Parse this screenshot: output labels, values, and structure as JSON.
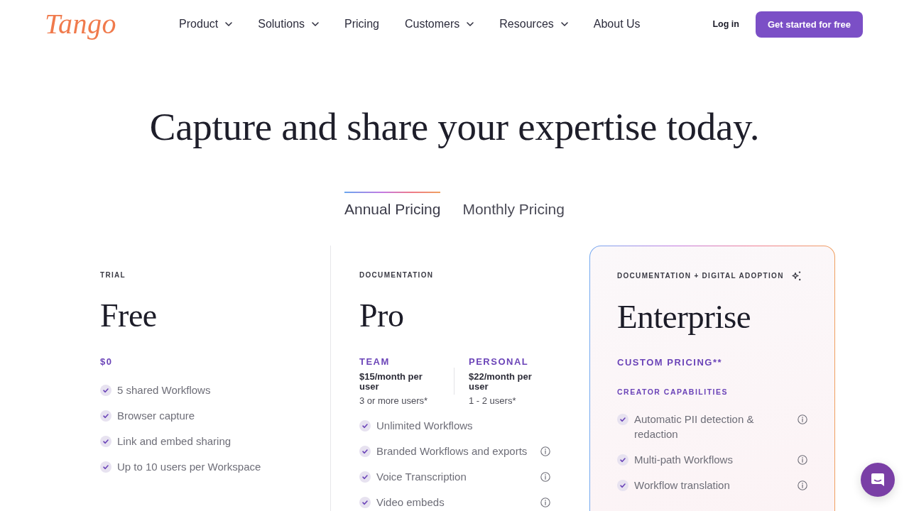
{
  "header": {
    "logo": "Tango",
    "nav": [
      {
        "label": "Product",
        "dropdown": true
      },
      {
        "label": "Solutions",
        "dropdown": true
      },
      {
        "label": "Pricing",
        "dropdown": false
      },
      {
        "label": "Customers",
        "dropdown": true
      },
      {
        "label": "Resources",
        "dropdown": true
      },
      {
        "label": "About Us",
        "dropdown": false
      }
    ],
    "login": "Log in",
    "cta": "Get started for free"
  },
  "headline": "Capture and share your expertise today.",
  "billing_tabs": [
    {
      "label": "Annual Pricing",
      "selected": true
    },
    {
      "label": "Monthly Pricing",
      "selected": false
    }
  ],
  "plans": [
    {
      "category": "TRIAL",
      "name": "Free",
      "featured": false,
      "price": "$0",
      "features": [
        {
          "text": "5 shared Workflows",
          "info": false
        },
        {
          "text": "Browser capture",
          "info": false
        },
        {
          "text": "Link and embed sharing",
          "info": false
        },
        {
          "text": "Up to 10 users per Workspace",
          "info": false
        }
      ]
    },
    {
      "category": "DOCUMENTATION",
      "name": "Pro",
      "featured": false,
      "tiers": [
        {
          "name": "TEAM",
          "price": "$15/month per user",
          "note": "3 or more users*"
        },
        {
          "name": "PERSONAL",
          "price": "$22/month per user",
          "note": "1 - 2 users*"
        }
      ],
      "features": [
        {
          "text": "Unlimited Workflows",
          "info": false
        },
        {
          "text": "Branded Workflows and exports",
          "info": true
        },
        {
          "text": "Voice Transcription",
          "info": true
        },
        {
          "text": "Video embeds",
          "info": true
        }
      ]
    },
    {
      "category": "DOCUMENTATION + DIGITAL ADOPTION",
      "name": "Enterprise",
      "featured": true,
      "price": "CUSTOM PRICING**",
      "section": "CREATOR CAPABILITIES",
      "features": [
        {
          "text": "Automatic PII detection & redaction",
          "info": true
        },
        {
          "text": "Multi-path Workflows",
          "info": true
        },
        {
          "text": "Workflow translation",
          "info": true
        }
      ]
    }
  ]
}
